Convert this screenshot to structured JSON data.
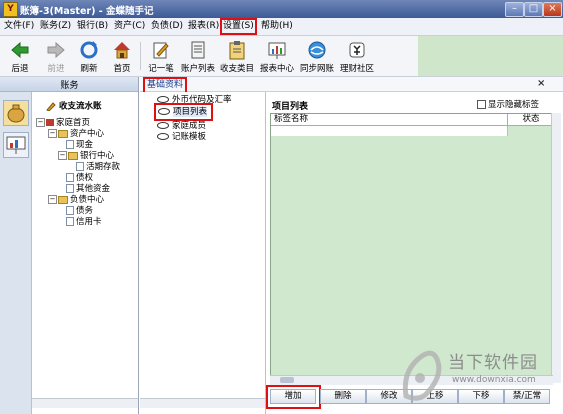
{
  "window": {
    "app_icon_glyph": "Y",
    "title": "账簿-3(Master) - 金蝶随手记",
    "minimize": "–",
    "maximize": "□",
    "close": "×"
  },
  "menu": {
    "items": [
      {
        "label": "文件(F)"
      },
      {
        "label": "账务(Z)"
      },
      {
        "label": "银行(B)"
      },
      {
        "label": "资产(C)"
      },
      {
        "label": "负债(D)"
      },
      {
        "label": "报表(R)"
      },
      {
        "label": "设置(S)"
      },
      {
        "label": "帮助(H)"
      }
    ]
  },
  "toolbar": {
    "back": "后退",
    "forward": "前进",
    "refresh": "刷新",
    "home": "首页",
    "record": "记一笔",
    "account_list": "账户列表",
    "categories": "收支类目",
    "report_center": "报表中心",
    "sync": "同步网账",
    "community": "理财社区"
  },
  "left_panel": {
    "header": "账务",
    "tree": {
      "journal": "收支流水账",
      "home": "家庭首页",
      "asset_center": "资产中心",
      "cash": "现金",
      "bank_center": "银行中心",
      "term_deposit": "活期存款",
      "creditor_rights": "债权",
      "other_funds": "其他资金",
      "liability_center": "负债中心",
      "debts": "债务",
      "credit_card": "信用卡"
    }
  },
  "main": {
    "tab_label": "基础资料",
    "close_label": "×",
    "categories": [
      {
        "label": "外币代码及汇率"
      },
      {
        "label": "项目列表"
      },
      {
        "label": "家庭成员"
      },
      {
        "label": "记账模板"
      }
    ],
    "panel_title": "项目列表",
    "show_hidden_label": "显示隐藏标签",
    "columns": {
      "tag_name": "标签名称",
      "status": "状态"
    },
    "buttons": {
      "add": "增加",
      "delete": "删除",
      "edit": "修改",
      "up": "上移",
      "down": "下移",
      "toggle": "禁/正常"
    }
  },
  "watermark": {
    "text": "当下软件园",
    "url": "www.downxia.com"
  },
  "colors": {
    "title_bar": "#3d5a96",
    "highlight_red": "#e01010",
    "grid_bg": "#cfe8ce",
    "toolbar_ext": "#cfe6cb"
  }
}
